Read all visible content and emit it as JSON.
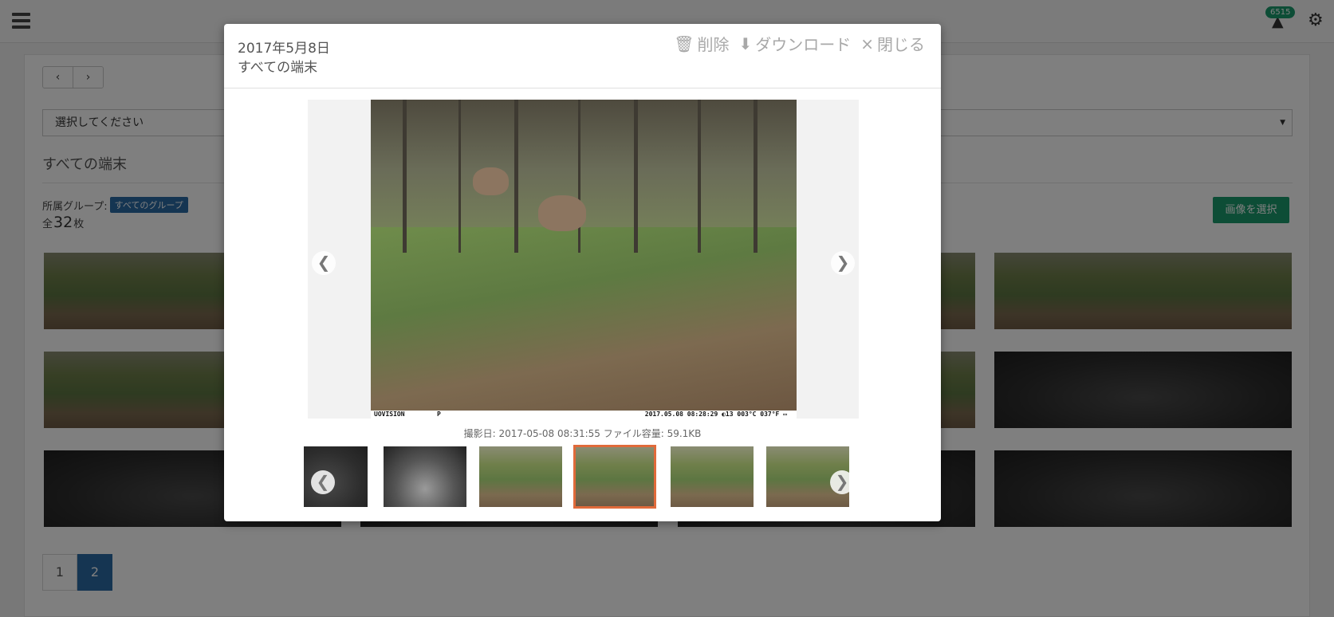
{
  "header": {
    "badge_count": "6515"
  },
  "toolbar": {
    "prev_label": "‹",
    "next_label": "›"
  },
  "filter": {
    "select_value": "選択してください"
  },
  "section": {
    "title": "すべての端末",
    "group_label": "所属グループ:",
    "group_badge": "すべてのグループ",
    "count_prefix": "全",
    "count_value": "32",
    "count_suffix": "枚",
    "select_images_label": "画像を選択"
  },
  "pagination": {
    "pages": [
      "1",
      "2"
    ],
    "active_page": "2"
  },
  "modal": {
    "date": "2017年5月8日",
    "device": "すべての端末",
    "delete_label": "削除",
    "download_label": "ダウンロード",
    "close_label": "閉じる",
    "stamp_left": "UOVISION",
    "stamp_mid": "P",
    "stamp_right": "2017.05.08 08:28:29 ◐13 003°C 037°F ▭",
    "caption": "撮影日: 2017-05-08 08:31:55 ファイル容量: 59.1KB"
  },
  "colors": {
    "accent": "#1b9a6c",
    "primary": "#2a6aa5",
    "selected_border": "#e06a3a"
  }
}
